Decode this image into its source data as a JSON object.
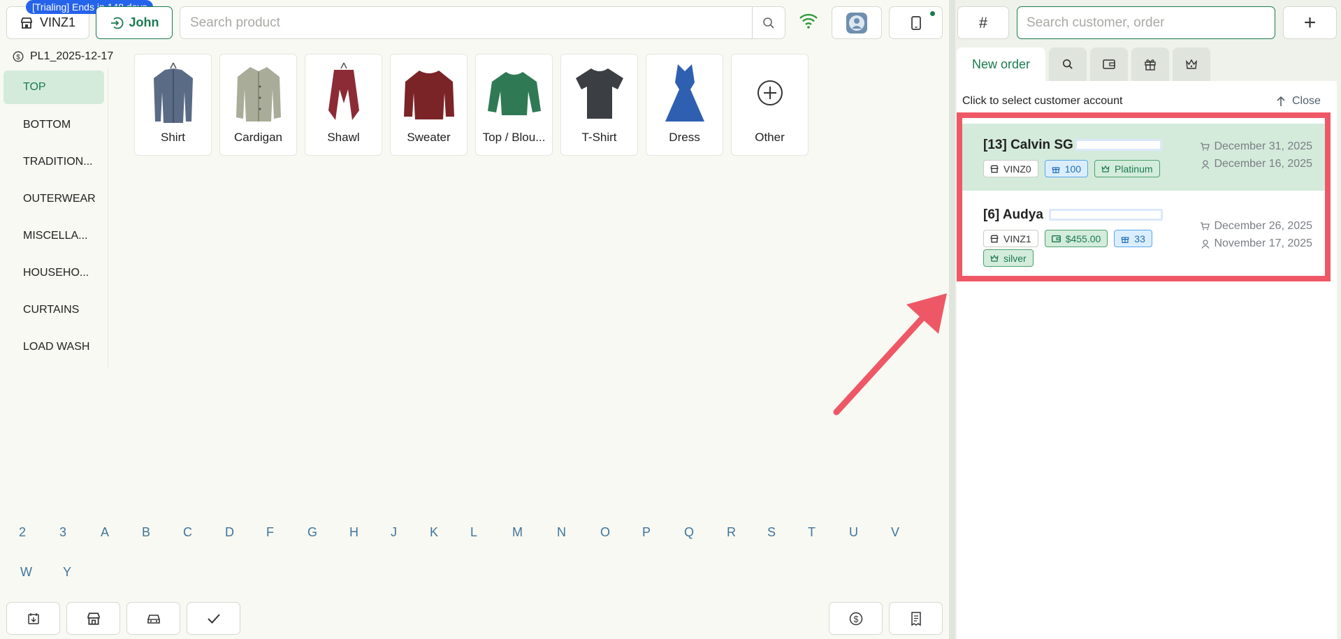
{
  "header": {
    "store_label": "VINZ1",
    "trial_badge": "[Trialing] Ends in 148 days",
    "user_label": "John",
    "search_placeholder": "Search product"
  },
  "pricelist": "PL1_2025-12-17",
  "categories": [
    {
      "label": "TOP",
      "active": true
    },
    {
      "label": "BOTTOM"
    },
    {
      "label": "TRADITION..."
    },
    {
      "label": "OUTERWEAR"
    },
    {
      "label": "MISCELLA..."
    },
    {
      "label": "HOUSEHO..."
    },
    {
      "label": "CURTAINS"
    },
    {
      "label": "LOAD WASH"
    }
  ],
  "products": [
    {
      "label": "Shirt",
      "color": "#5a6b86"
    },
    {
      "label": "Cardigan",
      "color": "#a9ac98"
    },
    {
      "label": "Shawl",
      "color": "#8c2b35"
    },
    {
      "label": "Sweater",
      "color": "#7a2428"
    },
    {
      "label": "Top / Blou...",
      "color": "#2f7a55"
    },
    {
      "label": "T-Shirt",
      "color": "#3b3e43"
    },
    {
      "label": "Dress",
      "color": "#2f5fb0"
    },
    {
      "label": "Other"
    }
  ],
  "alphabet_row1": [
    "2",
    "3",
    "A",
    "B",
    "C",
    "D",
    "F",
    "G",
    "H",
    "J",
    "K",
    "L",
    "M",
    "N",
    "O",
    "P",
    "Q",
    "R",
    "S",
    "T",
    "U",
    "V"
  ],
  "alphabet_row2": [
    "W",
    "Y"
  ],
  "panel": {
    "hash_label": "#",
    "search_placeholder": "Search customer, order",
    "plus_label": "+",
    "tab_new_order": "New order",
    "hint": "Click to select customer account",
    "close_label": "Close"
  },
  "customers": [
    {
      "id": "[13]",
      "name": "Calvin SG",
      "store": "VINZ0",
      "points": "100",
      "tier": "Platinum",
      "last_order": "December 31, 2025",
      "joined": "December 16, 2025"
    },
    {
      "id": "[6]",
      "name": "Audya",
      "store": "VINZ1",
      "wallet": "$455.00",
      "points": "33",
      "tier": "silver",
      "last_order": "December 26, 2025",
      "joined": "November 17, 2025"
    }
  ],
  "colors": {
    "accent": "#1b7a4f",
    "active_bg": "#d4ebdb",
    "highlight": "#ee5866",
    "badge": "#2563eb"
  }
}
